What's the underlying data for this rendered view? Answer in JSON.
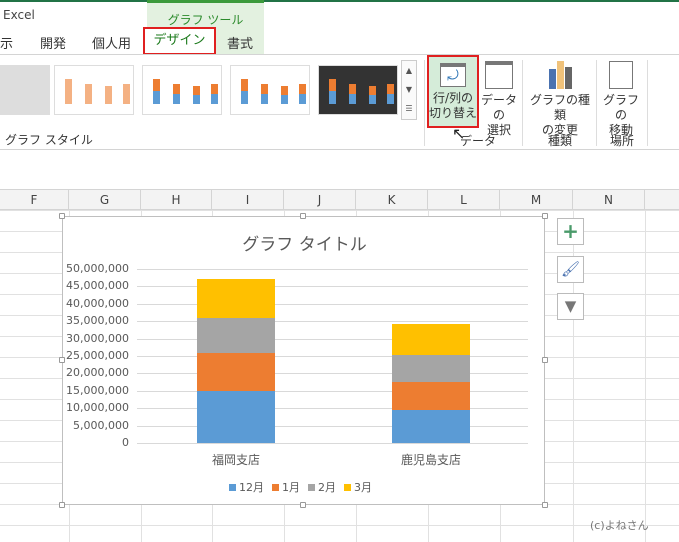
{
  "app": {
    "title": "Excel"
  },
  "context_tab": {
    "label": "グラフ ツール"
  },
  "tabs": [
    {
      "label": "示"
    },
    {
      "label": "開発"
    },
    {
      "label": "個人用"
    },
    {
      "label": "デザイン"
    },
    {
      "label": "書式"
    }
  ],
  "ribbon": {
    "style_group_label": "グラフ スタイル",
    "switch_row_col": {
      "line1": "行/列の",
      "line2": "切り替え"
    },
    "select_data": {
      "line1": "データの",
      "line2": "選択"
    },
    "data_group_label": "データ",
    "change_type": {
      "line1": "グラフの種類",
      "line2": "の変更"
    },
    "type_group_label": "種類",
    "move_chart": {
      "line1": "グラフの",
      "line2": "移動"
    },
    "location_group_label": "場所"
  },
  "columns": [
    "F",
    "G",
    "H",
    "I",
    "J",
    "K",
    "L",
    "M",
    "N"
  ],
  "chart_data": {
    "type": "bar",
    "stacked": true,
    "title": "グラフ タイトル",
    "categories": [
      "福岡支店",
      "鹿児島支店"
    ],
    "series": [
      {
        "name": "12月",
        "color": "#5b9bd5",
        "values": [
          15000000,
          9400000
        ]
      },
      {
        "name": "1月",
        "color": "#ed7d31",
        "values": [
          11000000,
          8100000
        ]
      },
      {
        "name": "2月",
        "color": "#a5a5a5",
        "values": [
          10000000,
          7700000
        ]
      },
      {
        "name": "3月",
        "color": "#ffc000",
        "values": [
          11200000,
          8900000
        ]
      }
    ],
    "ylim": [
      0,
      50000000
    ],
    "yticks": [
      "0",
      "5,000,000",
      "10,000,000",
      "15,000,000",
      "20,000,000",
      "25,000,000",
      "30,000,000",
      "35,000,000",
      "40,000,000",
      "45,000,000",
      "50,000,000"
    ],
    "legend": "bottom",
    "grid": true
  },
  "credit": "(c)よねさん"
}
